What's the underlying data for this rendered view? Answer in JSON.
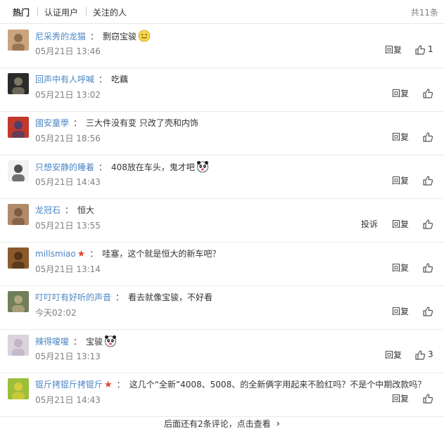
{
  "tabs": [
    "热门",
    "认证用户",
    "关注的人"
  ],
  "total": "共11条",
  "reply_label": "回复",
  "report_label": "投诉",
  "comments": [
    {
      "user": "尼采秀的龙猫",
      "vip": false,
      "text": "剽窃宝骏",
      "emoji": "smile-emoji",
      "time": "05月21日 13:46",
      "likes": "1",
      "report": false,
      "avatar_colors": [
        "#c9a47e",
        "#7a5a3a"
      ]
    },
    {
      "user": "回声中有人呼喊",
      "vip": false,
      "text": "吃藕",
      "emoji": "",
      "time": "05月21日 13:02",
      "likes": "",
      "report": false,
      "avatar_colors": [
        "#2b2b2b",
        "#9a8f7a"
      ]
    },
    {
      "user": "國安童學",
      "vip": false,
      "text": "三大件没有变 只改了壳和内饰",
      "emoji": "",
      "time": "05月21日 18:56",
      "likes": "",
      "report": false,
      "avatar_colors": [
        "#c0392b",
        "#2c3e80"
      ]
    },
    {
      "user": "只想安静的睡着",
      "vip": false,
      "text": "408放在车头，鬼才吧",
      "emoji": "panda-emoji",
      "time": "05月21日 14:43",
      "likes": "",
      "report": false,
      "avatar_colors": [
        "#f2f2f2",
        "#1a1a1a"
      ]
    },
    {
      "user": "龙冠石",
      "vip": false,
      "text": "恒大",
      "emoji": "",
      "time": "05月21日 13:55",
      "likes": "",
      "report": true,
      "avatar_colors": [
        "#b08a6a",
        "#6d4c36"
      ]
    },
    {
      "user": "millsmiao",
      "vip": true,
      "text": "哇塞，这个就是恒大的新车吧？",
      "emoji": "",
      "time": "05月21日 13:14",
      "likes": "",
      "report": false,
      "avatar_colors": [
        "#8b5a2b",
        "#3d2814"
      ]
    },
    {
      "user": "叮叮叮有好听的声音",
      "vip": false,
      "text": "看去就像宝骏，不好看",
      "emoji": "",
      "time": "今天02:02",
      "likes": "",
      "report": false,
      "avatar_colors": [
        "#6e7f5a",
        "#c9b38a"
      ]
    },
    {
      "user": "辣得嗄嗄",
      "vip": false,
      "text": "宝骏",
      "emoji": "panda-emoji",
      "time": "05月21日 13:13",
      "likes": "3",
      "report": false,
      "avatar_colors": [
        "#d9d3dc",
        "#b9a8c0"
      ]
    },
    {
      "user": "锟斤拷锟斤拷锟斤",
      "vip": true,
      "text": "这几个“全新”4008、5008、的全新俩字用起来不脸红吗？不是个中期改款吗？",
      "emoji": "",
      "time": "05月21日 14:43",
      "likes": "",
      "report": false,
      "avatar_colors": [
        "#9bbf3a",
        "#e8d23a"
      ]
    }
  ],
  "more_text": "后面还有2条评论，点击查看",
  "more_arrow": "›"
}
